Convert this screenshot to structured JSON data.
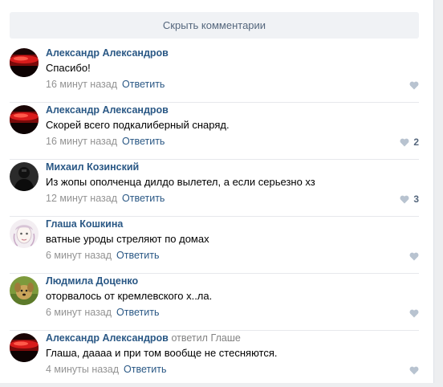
{
  "hide_comments_label": "Скрыть комментарии",
  "like_color": "#b8c3d0",
  "comments": [
    {
      "author": "Александр Александров",
      "replied": "",
      "replied_to": "",
      "text": "Спасибо!",
      "time": "16 минут назад",
      "reply_label": "Ответить",
      "likes": "",
      "avatar_icon": "red-sunset-avatar"
    },
    {
      "author": "Александр Александров",
      "replied": "",
      "replied_to": "",
      "text": "Скорей всего подкалиберный снаряд.",
      "time": "16 минут назад",
      "reply_label": "Ответить",
      "likes": "2",
      "avatar_icon": "red-sunset-avatar"
    },
    {
      "author": "Михаил Козинский",
      "replied": "",
      "replied_to": "",
      "text": "Из жопы ополченца дилдо вылетел, а если серьезно хз",
      "time": "12 минут назад",
      "reply_label": "Ответить",
      "likes": "3",
      "avatar_icon": "dark-figure-avatar"
    },
    {
      "author": "Глаша Кошкина",
      "replied": "",
      "replied_to": "",
      "text": "ватные уроды стреляют по домах",
      "time": "6 минут назад",
      "reply_label": "Ответить",
      "likes": "",
      "avatar_icon": "drawn-face-avatar"
    },
    {
      "author": "Людмила Доценко",
      "replied": "",
      "replied_to": "",
      "text": "оторвалось от кремлевского х..ла.",
      "time": "6 минут назад",
      "reply_label": "Ответить",
      "likes": "",
      "avatar_icon": "dog-photo-avatar"
    },
    {
      "author": "Александр Александров",
      "replied": "ответил",
      "replied_to": "Глаше",
      "text": "Глаша, даааа и при том вообще не стесняются.",
      "time": "4 минуты назад",
      "reply_label": "Ответить",
      "likes": "",
      "avatar_icon": "red-sunset-avatar"
    }
  ]
}
